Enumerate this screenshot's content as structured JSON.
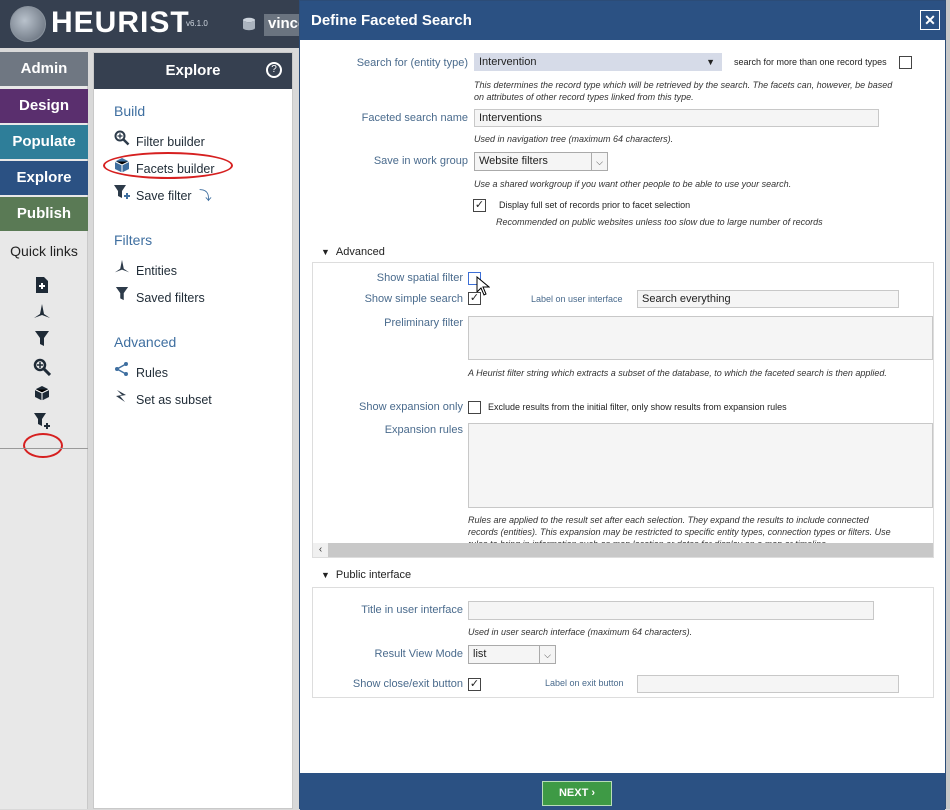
{
  "header": {
    "logo_text": "HEURIST",
    "version": "v6.1.0",
    "user": "vince"
  },
  "left_menu": {
    "items": [
      {
        "label": "Admin",
        "color": "#6f7782"
      },
      {
        "label": "Design",
        "color": "#5a2f6e"
      },
      {
        "label": "Populate",
        "color": "#2e7e99"
      },
      {
        "label": "Explore",
        "color": "#2b5183"
      },
      {
        "label": "Publish",
        "color": "#5a7a55"
      }
    ],
    "quick_links_label": "Quick links",
    "quick_link_icons": [
      "add-record-icon",
      "entities-icon",
      "filter-icon",
      "filter-builder-icon",
      "facets-cube-icon",
      "add-filter-icon"
    ]
  },
  "explore": {
    "title": "Explore",
    "build_header": "Build",
    "build_items": [
      "Filter builder",
      "Facets builder",
      "Save filter"
    ],
    "filters_header": "Filters",
    "filters_items": [
      "Entities",
      "Saved filters"
    ],
    "advanced_header": "Advanced",
    "advanced_items": [
      "Rules",
      "Set as subset"
    ]
  },
  "dialog": {
    "title": "Define Faceted Search",
    "search_for_label": "Search for (entity type)",
    "search_for_value": "Intervention",
    "multi_types_label": "search for more than one record types",
    "search_for_help": "This determines the record type which will be retrieved by the search. The facets can, however, be based on attributes of other record types linked from this type.",
    "name_label": "Faceted search name",
    "name_value": "Interventions",
    "name_help": "Used in navigation tree (maximum 64 characters).",
    "workgroup_label": "Save in work group",
    "workgroup_value": "Website filters",
    "workgroup_help": "Use a shared workgroup if you want other people to be able to use your search.",
    "display_full_label": "Display full set of records prior to facet selection",
    "display_full_help": "Recommended on public websites unless too slow due to large number of records",
    "advanced_header": "Advanced",
    "spatial_label": "Show spatial filter",
    "simple_search_label": "Show simple search",
    "ui_label_label": "Label on user interface",
    "ui_label_value": "Search everything",
    "preliminary_label": "Preliminary filter",
    "preliminary_help": "A Heurist filter string which extracts a subset of the database, to which the faceted search is then applied.",
    "expansion_only_label": "Show expansion only",
    "expansion_only_text": "Exclude results from the initial filter, only show results from expansion rules",
    "expansion_rules_label": "Expansion rules",
    "expansion_help": "Rules are applied to the result set after each selection. They expand the results to include connected records (entities). This expansion may be restricted to specific entity types, connection types or filters. Use rules to bring in information such as map location or dates for display on a map or timeline.",
    "public_header": "Public interface",
    "title_ui_label": "Title in user interface",
    "title_ui_help": "Used in user search interface (maximum 64 characters).",
    "view_mode_label": "Result View Mode",
    "view_mode_value": "list",
    "close_btn_label": "Show close/exit button",
    "exit_label_label": "Label on exit button",
    "next_label": "NEXT"
  }
}
